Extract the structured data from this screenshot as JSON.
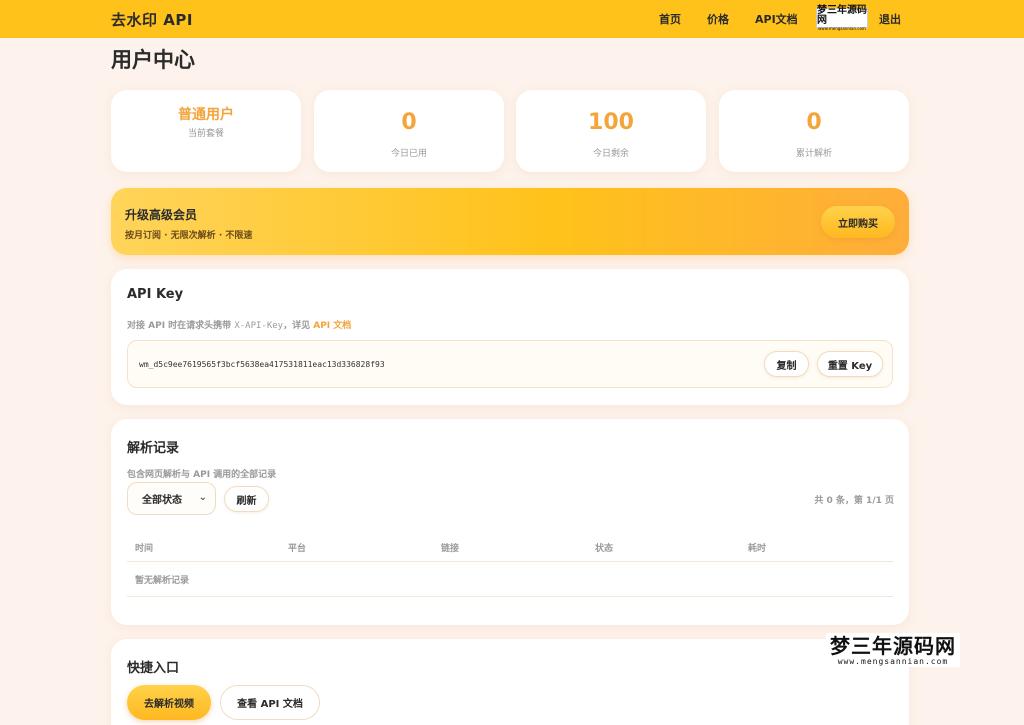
{
  "header": {
    "brand": "去水印 API",
    "nav": [
      "首页",
      "价格",
      "API文档"
    ],
    "nav_logo": {
      "big": "梦三年源码网",
      "small": "www.mengsannian.com"
    },
    "logout": "退出"
  },
  "page": {
    "title": "用户中心"
  },
  "stats": [
    {
      "value": "普通用户",
      "label": "当前套餐"
    },
    {
      "value": "0",
      "label": "今日已用"
    },
    {
      "value": "100",
      "label": "今日剩余"
    },
    {
      "value": "0",
      "label": "累计解析"
    }
  ],
  "upgrade": {
    "title": "升级高级会员",
    "subtitle": "按月订阅 · 无限次解析 · 不限速",
    "button": "立即购买"
  },
  "api_key": {
    "title": "API Key",
    "hint_pre": "对接 API 时在请求头携带 ",
    "hint_code": "X-API-Key",
    "hint_mid": "，详见 ",
    "hint_link": "API 文档",
    "value": "wm_d5c9ee7619565f3bcf5638ea417531811eac13d336828f93",
    "copy_button": "复制",
    "reset_button": "重置 Key"
  },
  "records": {
    "title": "解析记录",
    "hint": "包含网页解析与 API 调用的全部记录",
    "filter_selected": "全部状态",
    "refresh_button": "刷新",
    "count_text": "共 0 条，第 1/1 页",
    "columns": [
      "时间",
      "平台",
      "链接",
      "状态",
      "耗时"
    ],
    "empty_text": "暂无解析记录"
  },
  "quick": {
    "title": "快捷入口",
    "primary_button": "去解析视频",
    "secondary_button": "查看 API 文档"
  },
  "watermark": {
    "big": "梦三年源码网",
    "small": "www.mengsannian.com"
  },
  "colors": {
    "accent": "#ffc21a",
    "highlight": "#f4a43a",
    "background": "#fdf3ec"
  }
}
